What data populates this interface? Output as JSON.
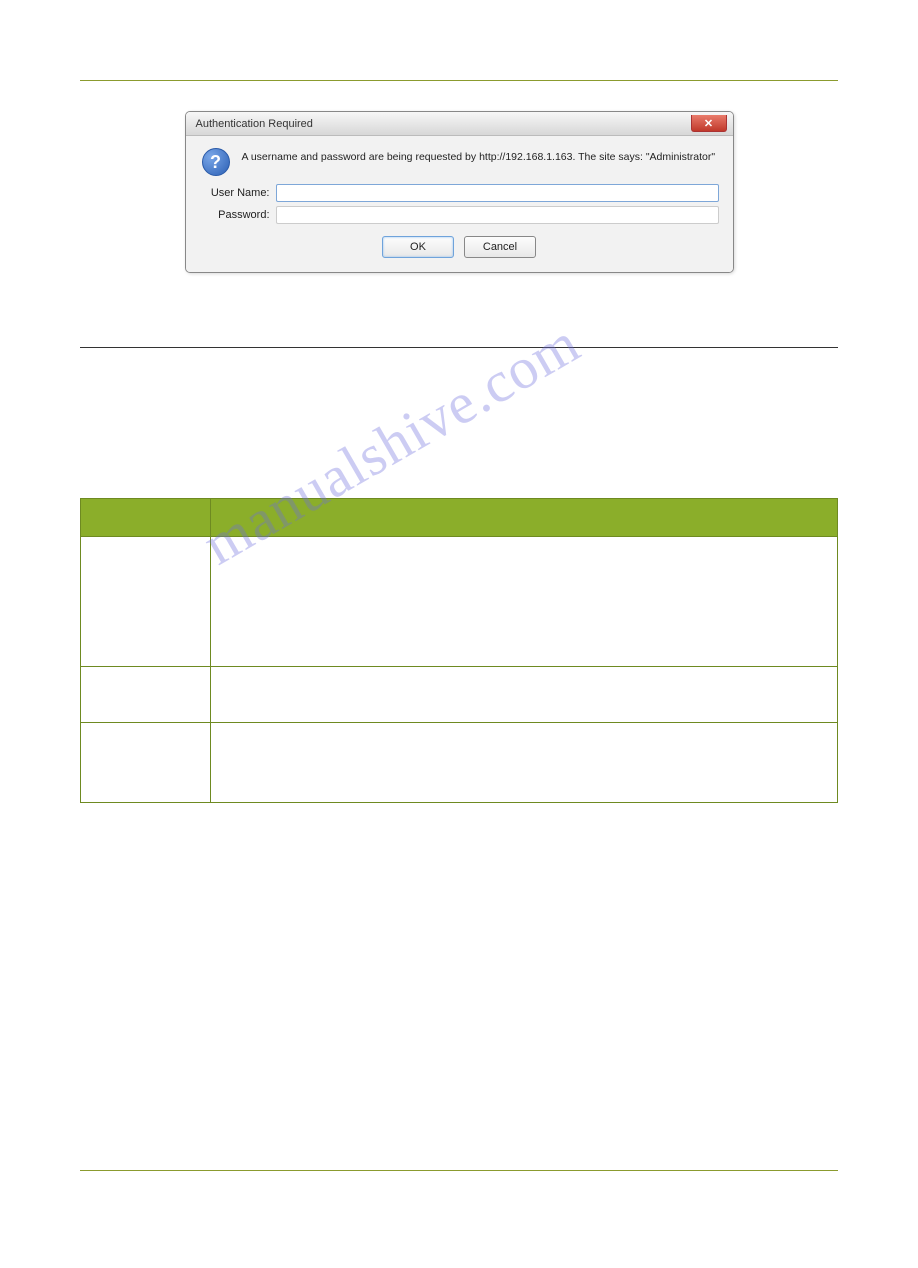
{
  "dialog": {
    "title": "Authentication Required",
    "message": "A username and password are being requested by http://192.168.1.163. The site says: \"Administrator\"",
    "user_label": "User Name:",
    "password_label": "Password:",
    "user_value": "",
    "password_value": "",
    "ok_label": "OK",
    "cancel_label": "Cancel"
  },
  "watermark": "manualshive.com"
}
